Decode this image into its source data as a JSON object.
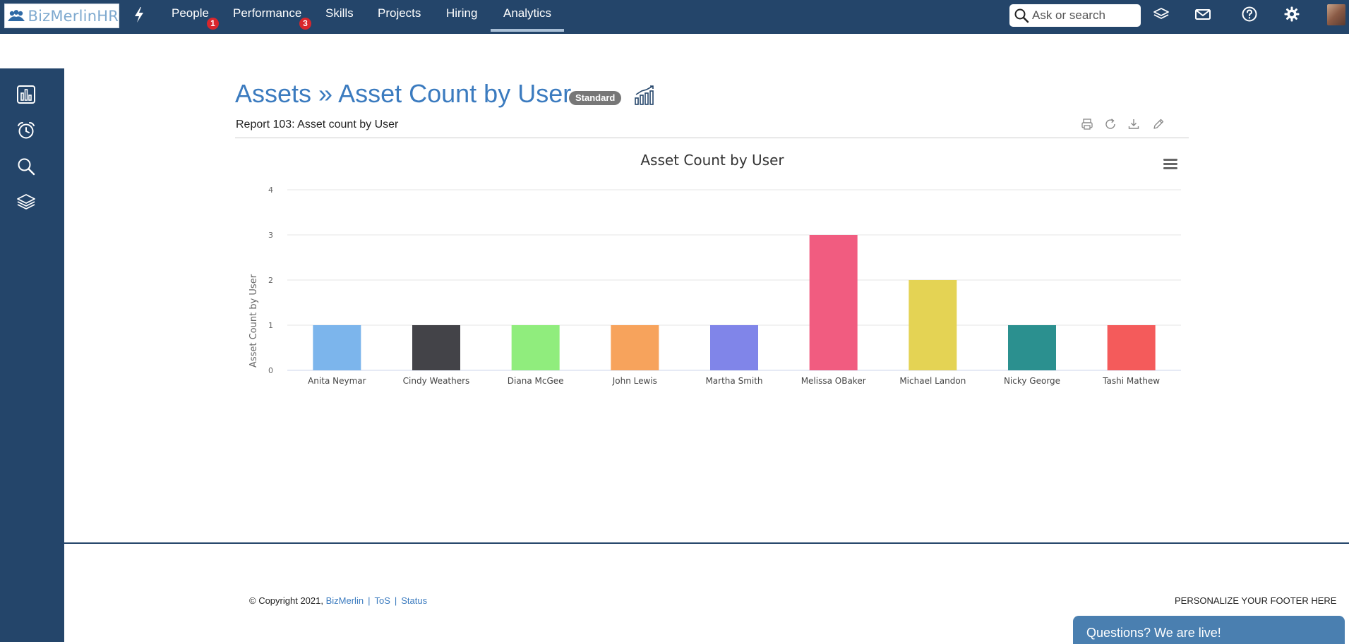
{
  "topnav": {
    "logo_text": "BizMerlinHR",
    "items": [
      {
        "label": "People",
        "badge": "1"
      },
      {
        "label": "Performance",
        "badge": "3"
      },
      {
        "label": "Skills"
      },
      {
        "label": "Projects"
      },
      {
        "label": "Hiring"
      },
      {
        "label": "Analytics",
        "active": true
      }
    ],
    "search_placeholder": "Ask or search",
    "icons": [
      "bolt-icon",
      "layers-icon",
      "mail-icon",
      "help-icon",
      "gear-icon",
      "avatar"
    ]
  },
  "sidebar": {
    "icons": [
      "chart-icon",
      "alarm-clock-icon",
      "search-icon",
      "layers-icon"
    ]
  },
  "header": {
    "title": "Assets » Asset Count by User",
    "badge": "Standard",
    "subtitle": "Report  103: Asset count by User",
    "tools": [
      "print-icon",
      "refresh-icon",
      "download-icon",
      "edit-icon"
    ]
  },
  "chart_data": {
    "type": "bar",
    "title": "Asset Count by User",
    "xlabel": "",
    "ylabel": "Asset Count by User",
    "ylim": [
      0,
      4
    ],
    "yticks": [
      "0",
      "1",
      "2",
      "3",
      "4"
    ],
    "grid": true,
    "legend": "none",
    "categories": [
      "Anita Neymar",
      "Cindy Weathers",
      "Diana McGee",
      "John Lewis",
      "Martha Smith",
      "Melissa OBaker",
      "Michael Landon",
      "Nicky George",
      "Tashi Mathew"
    ],
    "values": [
      1,
      1,
      1,
      1,
      1,
      3,
      2,
      1,
      1
    ],
    "colors": [
      "#7cb5ec",
      "#434348",
      "#90ed7d",
      "#f7a35c",
      "#8085e9",
      "#f15c80",
      "#e4d354",
      "#2b908f",
      "#f45b5b"
    ]
  },
  "footer": {
    "copyright_prefix": "© Copyright 2021,",
    "company_link": "BizMerlin",
    "tos_link": "ToS",
    "status_link": "Status",
    "separator": "|",
    "personalize": "PERSONALIZE YOUR FOOTER HERE",
    "live_chat": "Questions? We are live!"
  },
  "colors": {
    "nav_bg": "#24456a",
    "title_blue": "#3b7bbf",
    "badge_red": "#d9262c"
  }
}
